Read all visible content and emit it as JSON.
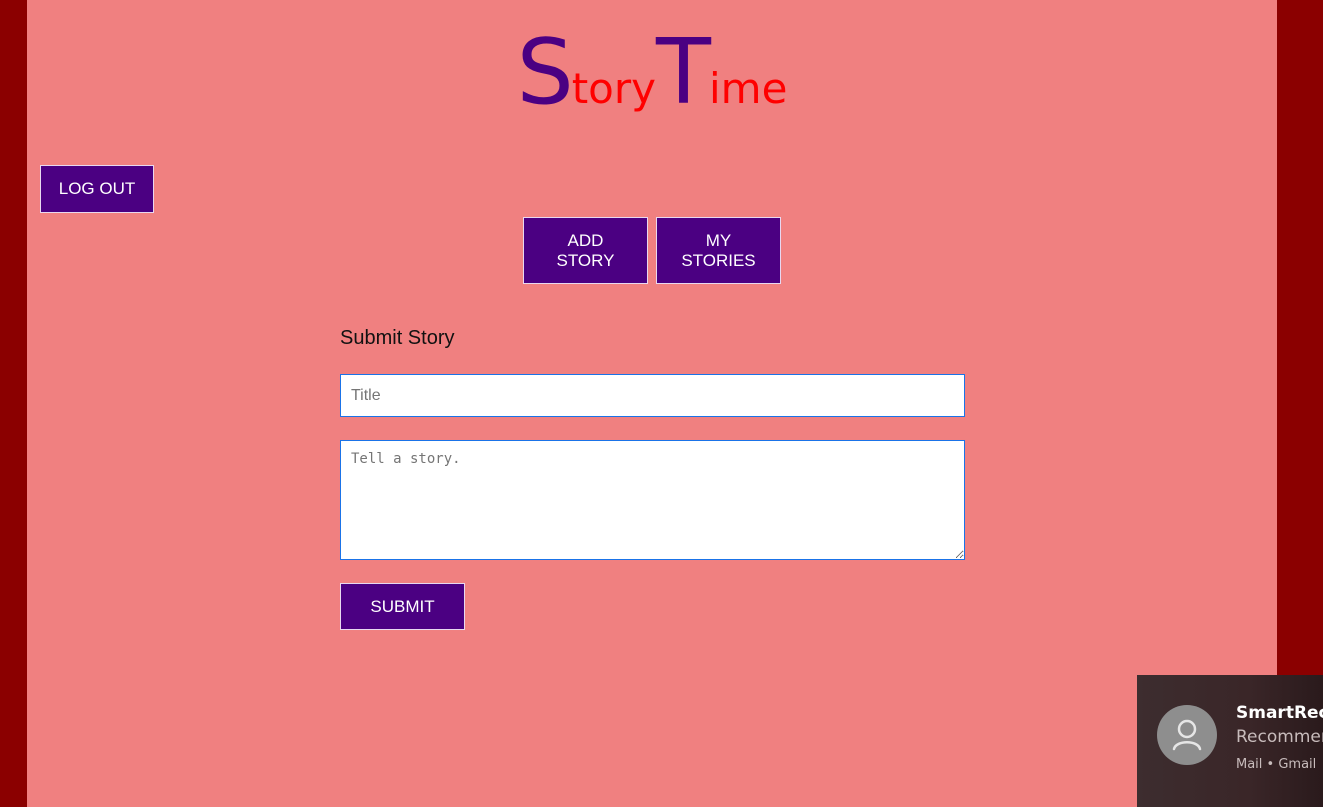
{
  "logo": {
    "first_initial": "S",
    "first_rest": "tory",
    "second_initial": "T",
    "second_rest": "ime",
    "colors": {
      "initials": "#4b0082",
      "rest": "#ff0000"
    }
  },
  "header": {
    "logout_label": "LOG OUT"
  },
  "nav": {
    "add_story_line1": "ADD",
    "add_story_line2": "STORY",
    "my_stories_line1": "MY",
    "my_stories_line2": "STORIES"
  },
  "form": {
    "heading": "Submit Story",
    "title_placeholder": "Title",
    "title_value": "",
    "story_placeholder": "Tell a story.",
    "story_value": "",
    "submit_label": "SUBMIT"
  },
  "notification": {
    "sender": "SmartRecr",
    "preview": "Recommer",
    "source": "Mail • Gmail",
    "icon": "person-icon"
  },
  "colors": {
    "page_background": "#f08080",
    "frame_background": "#8b0000",
    "button_background": "#4b0082",
    "button_text": "#ffffff"
  }
}
